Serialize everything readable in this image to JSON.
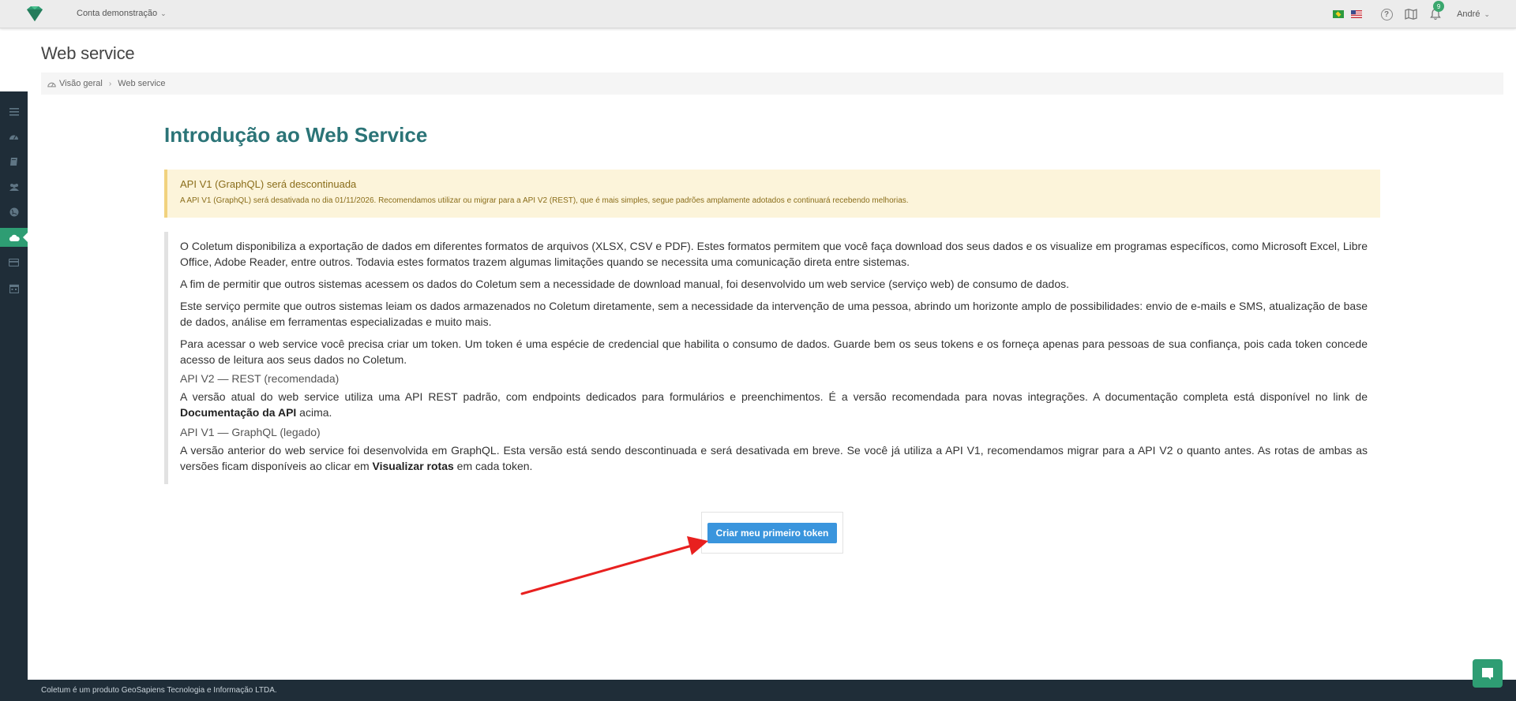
{
  "topbar": {
    "account_label": "Conta demonstração",
    "notification_count": "9",
    "user_name": "André",
    "help_glyph": "?",
    "icons": [
      "logo-icon",
      "flag-br-icon",
      "flag-us-icon",
      "help-icon",
      "map-icon",
      "bell-icon"
    ]
  },
  "header": {
    "title": "Web service"
  },
  "breadcrumb": {
    "items": [
      "Visão geral",
      "Web service"
    ]
  },
  "sidebar": {
    "items": [
      "list-icon",
      "dashboard-icon",
      "book-icon",
      "users-icon",
      "globe-icon",
      "cloud-icon",
      "card-icon",
      "calendar-icon"
    ],
    "active": "cloud-icon"
  },
  "main": {
    "heading": "Introdução ao Web Service",
    "alert": {
      "title": "API V1 (GraphQL) será descontinuada",
      "text": "A API V1 (GraphQL) será desativada no dia 01/11/2026. Recomendamos utilizar ou migrar para a API V2 (REST), que é mais simples, segue padrões amplamente adotados e continuará recebendo melhorias."
    },
    "paragraphs": [
      "O Coletum disponibiliza a exportação de dados em diferentes formatos de arquivos (XLSX, CSV e PDF). Estes formatos permitem que você faça download dos seus dados e os visualize em programas específicos, como Microsoft Excel, Libre Office, Adobe Reader, entre outros. Todavia estes formatos trazem algumas limitações quando se necessita uma comunicação direta entre sistemas.",
      "A fim de permitir que outros sistemas acessem os dados do Coletum sem a necessidade de download manual, foi desenvolvido um web service (serviço web) de consumo de dados.",
      "Este serviço permite que outros sistemas leiam os dados armazenados no Coletum diretamente, sem a necessidade da intervenção de uma pessoa, abrindo um horizonte amplo de possibilidades: envio de e-mails e SMS, atualização de base de dados, análise em ferramentas especializadas e muito mais.",
      "Para acessar o web service você precisa criar um token. Um token é uma espécie de credencial que habilita o consumo de dados. Guarde bem os seus tokens e os forneça apenas para pessoas de sua confiança, pois cada token concede acesso de leitura aos seus dados no Coletum."
    ],
    "v2": {
      "title": "API V2 — REST (recomendada)",
      "text_before": "A versão atual do web service utiliza uma API REST padrão, com endpoints dedicados para formulários e preenchimentos. É a versão recomendada para novas integrações. A documentação completa está disponível no link de ",
      "bold": "Documentação da API",
      "text_after": " acima."
    },
    "v1": {
      "title": "API V1 — GraphQL (legado)",
      "text_before": "A versão anterior do web service foi desenvolvida em GraphQL. Esta versão está sendo descontinuada e será desativada em breve. Se você já utiliza a API V1, recomendamos migrar para a API V2 o quanto antes. As rotas de ambas as versões ficam disponíveis ao clicar em ",
      "bold": "Visualizar rotas",
      "text_after": " em cada token."
    },
    "cta_label": "Criar meu primeiro token"
  },
  "footer": {
    "text": "Coletum é um produto GeoSapiens Tecnologia e Informação LTDA."
  },
  "colors": {
    "accent": "#2e9d73",
    "heading": "#2b7477",
    "button": "#3a95dd",
    "sidebar": "#1f2d38",
    "alert_bg": "#fcf4da",
    "annotation_arrow": "#e8201f"
  }
}
